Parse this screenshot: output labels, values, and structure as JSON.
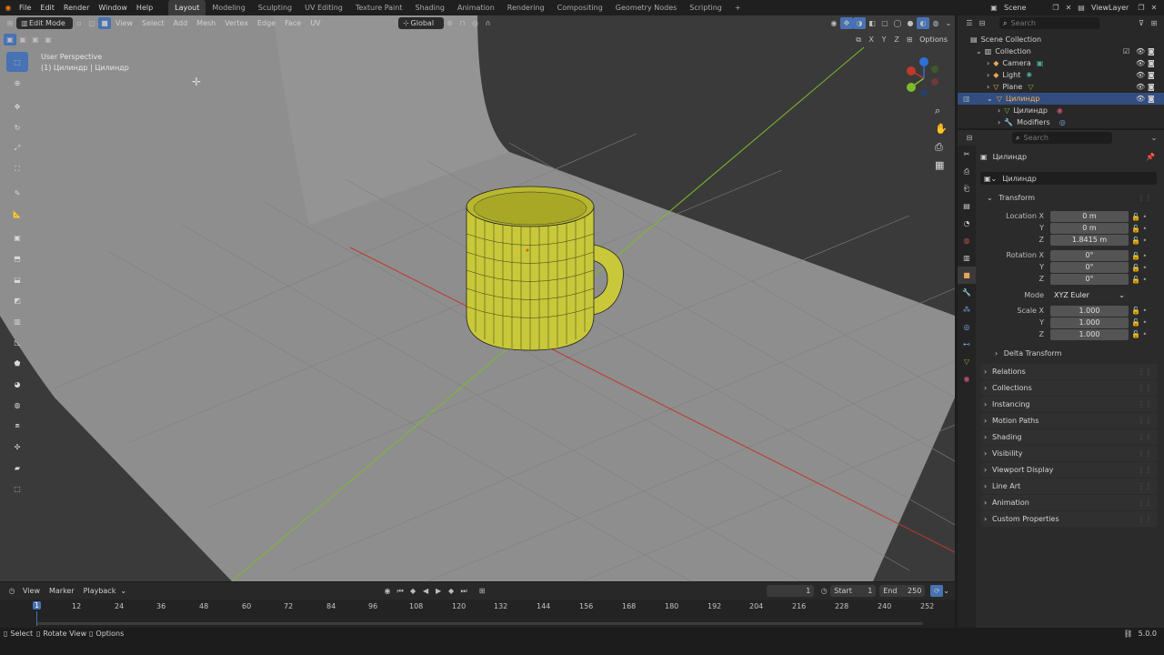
{
  "menu": {
    "file": "File",
    "edit": "Edit",
    "render": "Render",
    "window": "Window",
    "help": "Help"
  },
  "workspaces": [
    "Layout",
    "Modeling",
    "Sculpting",
    "UV Editing",
    "Texture Paint",
    "Shading",
    "Animation",
    "Rendering",
    "Compositing",
    "Geometry Nodes",
    "Scripting"
  ],
  "active_workspace": "Layout",
  "scene": {
    "name": "Scene",
    "view_layer": "ViewLayer"
  },
  "viewport_header": {
    "mode": "Edit Mode",
    "view": "View",
    "select": "Select",
    "add": "Add",
    "mesh": "Mesh",
    "vertex": "Vertex",
    "edge": "Edge",
    "face": "Face",
    "uv": "UV",
    "orientation": "Global",
    "options": "Options",
    "axes": [
      "X",
      "Y",
      "Z"
    ]
  },
  "viewport_info": {
    "line1": "User Perspective",
    "line2": "(1) Цилиндр | Цилиндр"
  },
  "outliner": {
    "search_placeholder": "Search",
    "root": "Scene Collection",
    "collection": "Collection",
    "items": [
      {
        "name": "Camera",
        "selected": false
      },
      {
        "name": "Light",
        "selected": false
      },
      {
        "name": "Plane",
        "selected": false
      },
      {
        "name": "Цилиндр",
        "selected": true
      }
    ],
    "children": [
      {
        "name": "Цилиндр"
      },
      {
        "name": "Modifiers"
      }
    ]
  },
  "properties": {
    "search_placeholder": "Search",
    "object_name": "Цилиндр",
    "data_name": "Цилиндр",
    "transform": {
      "title": "Transform",
      "location_label": "Location X",
      "loc_x": "0 m",
      "loc_y": "0 m",
      "loc_z": "1.8415 m",
      "rotation_label": "Rotation X",
      "rot_x": "0°",
      "rot_y": "0°",
      "rot_z": "0°",
      "mode_label": "Mode",
      "mode": "XYZ Euler",
      "scale_label": "Scale X",
      "scale_x": "1.000",
      "scale_y": "1.000",
      "scale_z": "1.000",
      "y": "Y",
      "z": "Z"
    },
    "delta": "Delta Transform",
    "panels": [
      "Relations",
      "Collections",
      "Instancing",
      "Motion Paths",
      "Shading",
      "Visibility",
      "Viewport Display",
      "Line Art",
      "Animation",
      "Custom Properties"
    ]
  },
  "timeline": {
    "view": "View",
    "marker": "Marker",
    "playback": "Playback",
    "current_frame": "1",
    "start_label": "Start",
    "start": "1",
    "end_label": "End",
    "end": "250",
    "ticks": [
      "1",
      "12",
      "24",
      "36",
      "48",
      "60",
      "72",
      "84",
      "96",
      "108",
      "120",
      "132",
      "144",
      "156",
      "168",
      "180",
      "192",
      "204",
      "216",
      "228",
      "240",
      "252"
    ]
  },
  "status": {
    "select": "Select",
    "rotate": "Rotate View",
    "options": "Options",
    "version": "5.0.0"
  },
  "colors": {
    "accent": "#4772b3",
    "mesh": "#c8c83a",
    "x_axis": "#c0392b",
    "y_axis": "#7dbb2a",
    "z_axis": "#2f6fd6"
  }
}
